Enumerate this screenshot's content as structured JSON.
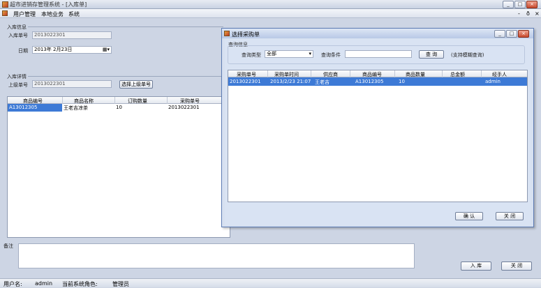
{
  "app": {
    "title": "超市进销存管理系统 - [入库单]"
  },
  "menu": {
    "items": [
      "用户管理",
      "本地业务",
      "系统"
    ]
  },
  "mdi_controls": [
    "-",
    "ð",
    "×"
  ],
  "form": {
    "group1_title": "入库信息",
    "order_no_label": "入库单号",
    "order_no_value": "2013022301",
    "date_label": "日期",
    "date_value": "2013年 2月23日",
    "group2_title": "入库详情",
    "purchase_no_label": "上级单号",
    "purchase_no_value": "2013022301",
    "select_button": "选择上级单号",
    "grid": {
      "columns": [
        "商品编号",
        "商品名称",
        "订购数量",
        "采购单号"
      ],
      "rows": [
        [
          "A13012305",
          "王老吉凉茶",
          "10",
          "2013022301"
        ]
      ]
    },
    "remark_label": "备注",
    "stock_in_button": "入 库",
    "close_button": "关 闭"
  },
  "dialog": {
    "title": "选择采购单",
    "group_title": "查询信息",
    "query_type_label": "查询类型",
    "query_type_value": "全部",
    "query_cond_label": "查询条件",
    "query_cond_value": "",
    "query_button": "查 询",
    "hint": "(支持模糊查询)",
    "grid": {
      "columns": [
        "采购单号",
        "采购单时间",
        "供应商",
        "商品编号",
        "商品数量",
        "总金额",
        "经手人"
      ],
      "rows": [
        [
          "2013022301",
          "2013/2/23 21:07",
          "王老吉",
          "A13012305",
          "10",
          "",
          "admin"
        ]
      ]
    },
    "ok_button": "确 认",
    "close_button": "关 闭"
  },
  "status": {
    "user_label": "用户名:",
    "user_value": "admin",
    "role_label": "当前系统角色:",
    "role_value": "管理员"
  }
}
